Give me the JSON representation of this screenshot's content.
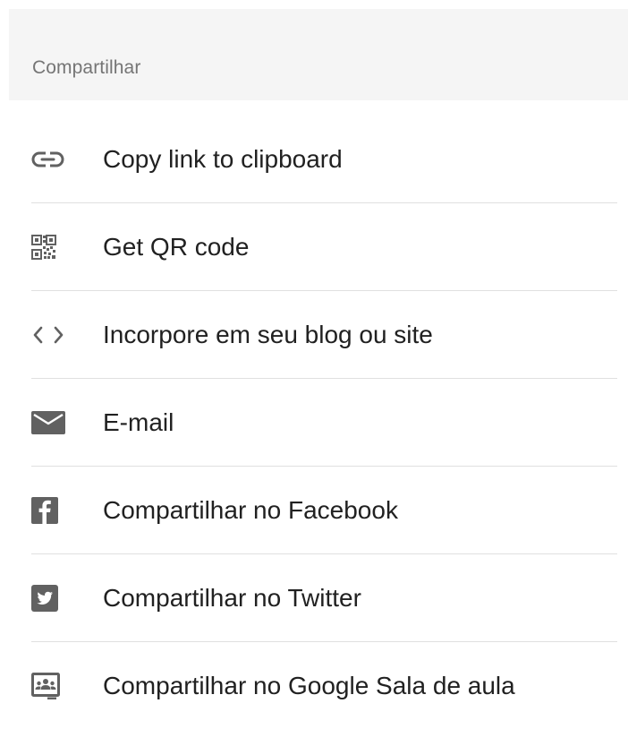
{
  "header": {
    "title": "Compartilhar"
  },
  "share_items": [
    {
      "icon": "link-icon",
      "label": "Copy link to clipboard"
    },
    {
      "icon": "qr-code-icon",
      "label": "Get QR code"
    },
    {
      "icon": "code-embed-icon",
      "label": "Incorpore em seu blog ou site"
    },
    {
      "icon": "email-icon",
      "label": "E-mail"
    },
    {
      "icon": "facebook-icon",
      "label": "Compartilhar no Facebook"
    },
    {
      "icon": "twitter-icon",
      "label": "Compartilhar no Twitter"
    },
    {
      "icon": "google-classroom-icon",
      "label": "Compartilhar no Google Sala de aula"
    }
  ],
  "colors": {
    "header_background": "#f5f5f5",
    "header_text": "#757575",
    "item_text": "#212121",
    "icon": "#616161",
    "divider": "#e0e0e0"
  }
}
